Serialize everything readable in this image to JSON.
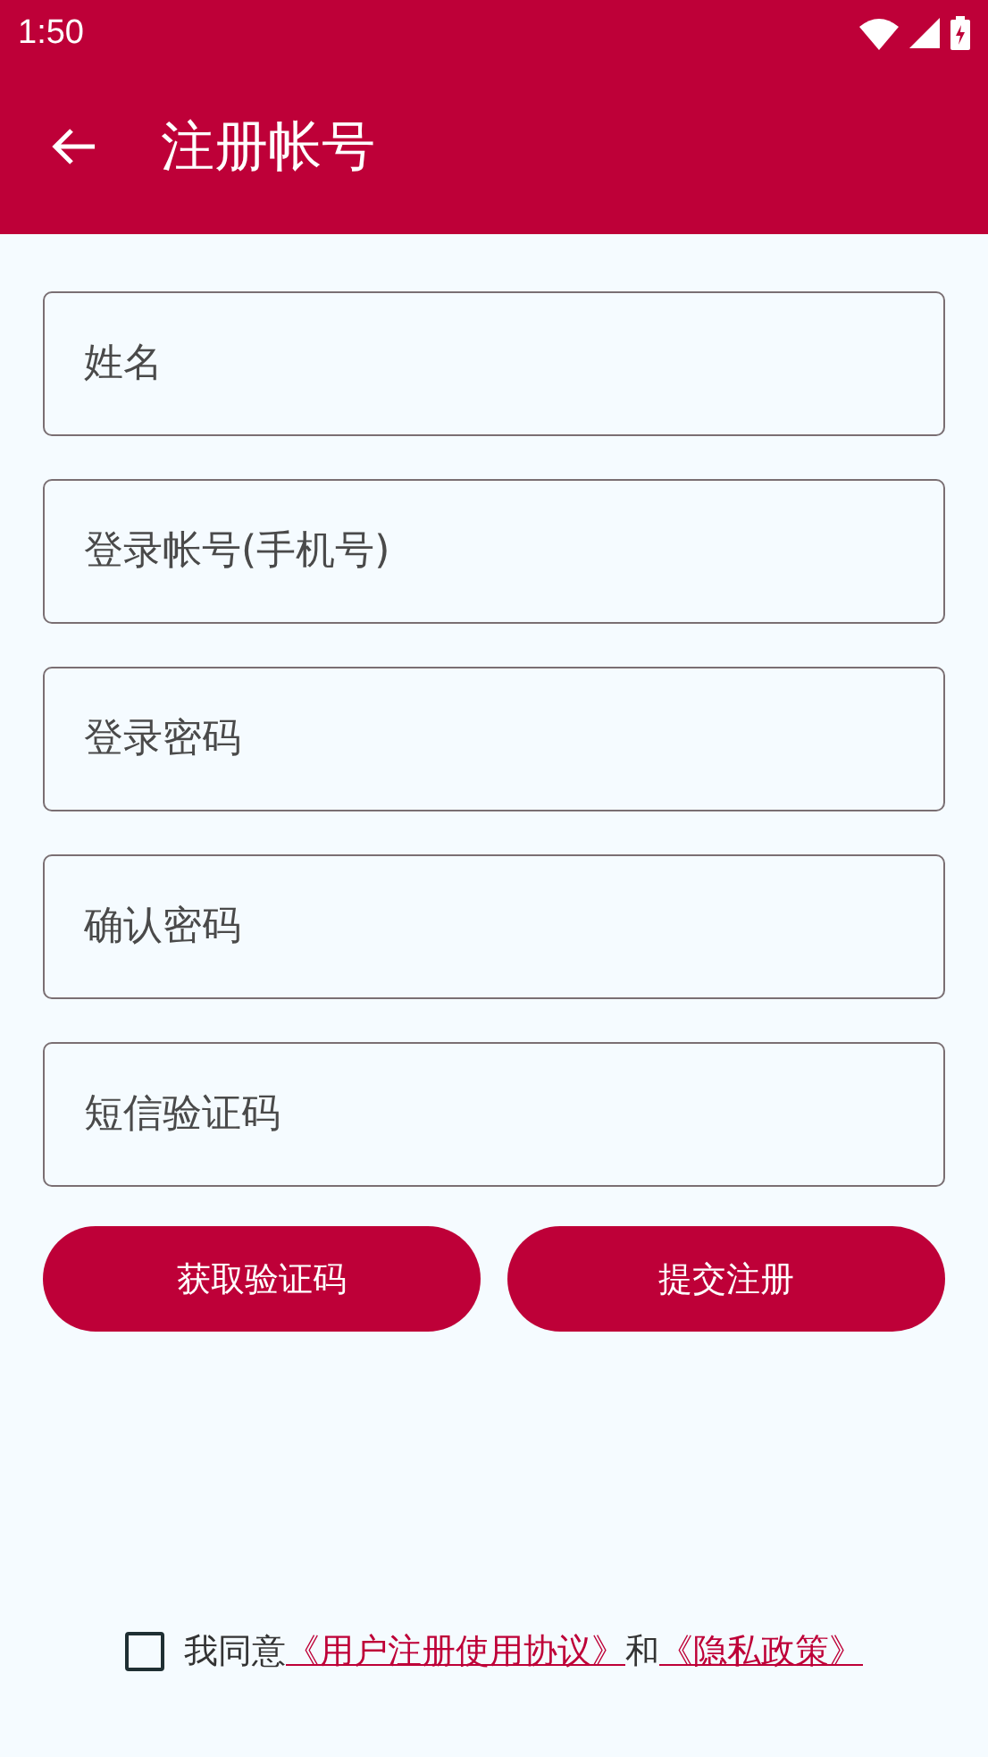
{
  "status_bar": {
    "time": "1:50"
  },
  "app_bar": {
    "title": "注册帐号"
  },
  "fields": [
    {
      "placeholder": "姓名"
    },
    {
      "placeholder": "登录帐号(手机号)"
    },
    {
      "placeholder": "登录密码"
    },
    {
      "placeholder": "确认密码"
    },
    {
      "placeholder": "短信验证码"
    }
  ],
  "buttons": [
    "获取验证码",
    "提交注册"
  ],
  "agreement": {
    "checked": false,
    "parts": [
      {
        "kind": "text",
        "text": "我同意"
      },
      {
        "kind": "link",
        "text": "《用户注册使用协议》"
      },
      {
        "kind": "text",
        "text": "和"
      },
      {
        "kind": "link",
        "text": "《隐私政策》"
      }
    ]
  }
}
